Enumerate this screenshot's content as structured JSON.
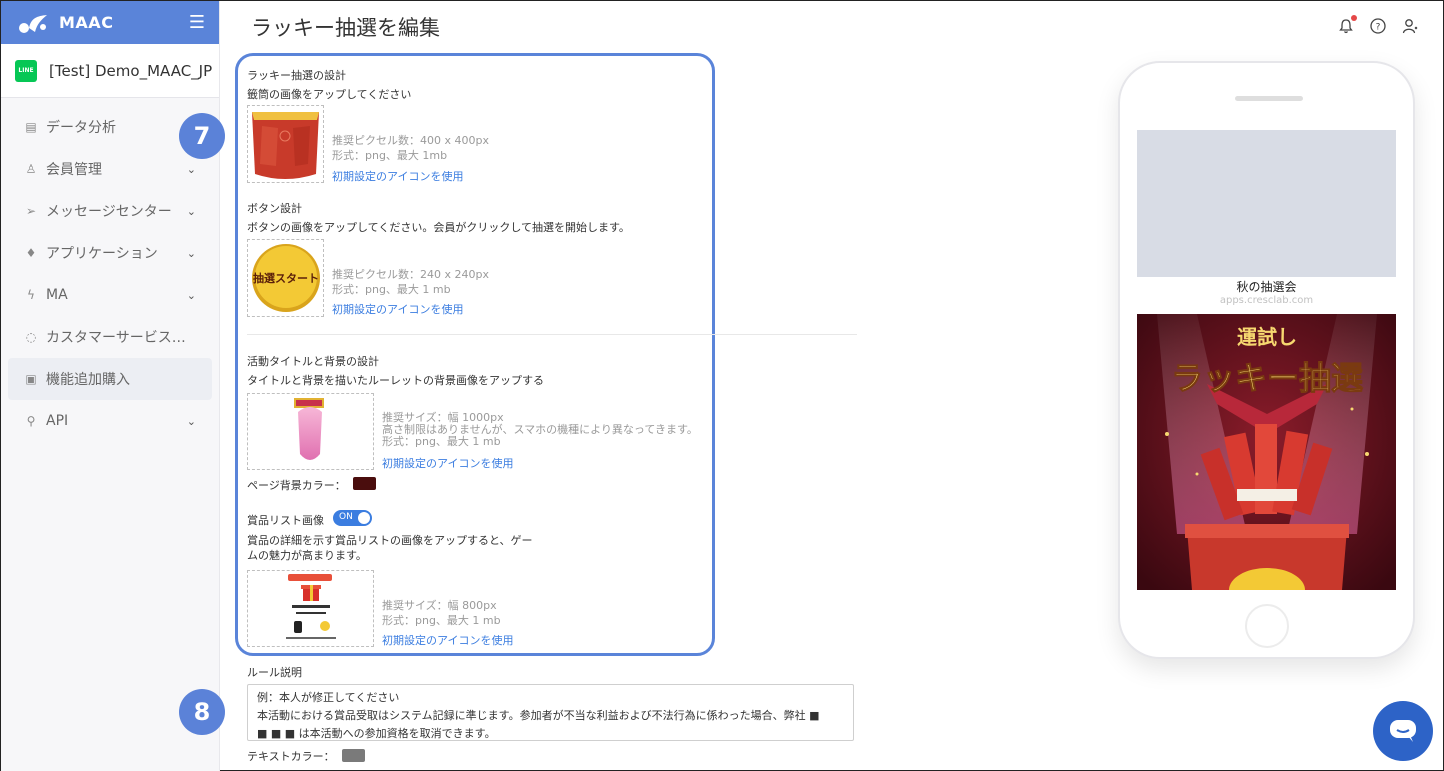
{
  "sidebar": {
    "brand": "MAAC",
    "account_name": "[Test] Demo_MAAC_JP",
    "line_badge": "LINE",
    "items": [
      {
        "label": "データ分析",
        "icon": "chart-icon",
        "chevron": false
      },
      {
        "label": "会員管理",
        "icon": "user-icon",
        "chevron": true
      },
      {
        "label": "メッセージセンター",
        "icon": "send-icon",
        "chevron": true
      },
      {
        "label": "アプリケーション",
        "icon": "rocket-icon",
        "chevron": true
      },
      {
        "label": "MA",
        "icon": "lightning-icon",
        "chevron": true
      },
      {
        "label": "カスタマーサービスチャット",
        "icon": "chat-icon",
        "chevron": false
      },
      {
        "label": "機能追加購入",
        "icon": "store-icon",
        "chevron": false,
        "active": true
      },
      {
        "label": "API",
        "icon": "api-icon",
        "chevron": true
      }
    ]
  },
  "header": {
    "title": "ラッキー抽選を編集"
  },
  "steps": {
    "step7": "7",
    "step8": "8"
  },
  "design": {
    "title": "ラッキー抽選の設計",
    "lottery_desc": "籤筒の画像をアップしてください",
    "lottery_hint1": "推奨ピクセル数：400 x 400px",
    "lottery_hint2": "形式：png、最大 1mb",
    "default_link": "初期設定のアイコンを使用",
    "button_title": "ボタン設計",
    "button_desc": "ボタンの画像をアップしてください。会員がクリックして抽選を開始します。",
    "button_img_text": "抽選スタート",
    "button_hint1": "推奨ピクセル数：240 x 240px",
    "button_hint2": "形式：png、最大 1 mb",
    "bg_title": "活動タイトルと背景の設計",
    "bg_desc": "タイトルと背景を描いたルーレットの背景画像をアップする",
    "bg_hint1": "推奨サイズ：幅 1000px",
    "bg_hint2": "高さ制限はありませんが、スマホの機種により異なってきます。",
    "bg_hint3": "形式：png、最大 1 mb",
    "bg_color_label": "ページ背景カラー：",
    "bg_color": "#4a0d0d",
    "prize_title": "賞品リスト画像",
    "prize_toggle": "ON",
    "prize_desc1": "賞品の詳細を示す賞品リストの画像をアップすると、ゲー",
    "prize_desc2": "ムの魅力が高まります。",
    "prize_hint1": "推奨サイズ：幅 800px",
    "prize_hint2": "形式：png、最大 1 mb"
  },
  "rules": {
    "title": "ルール説明",
    "line1": "例：本人が修正してください",
    "line2": "本活動における賞品受取はシステム記録に準じます。参加者が不当な利益および不法行為に係わった場合、弊社 ■",
    "line3": "■ ■ ■ は本活動への参加資格を取消できます。",
    "text_color_label": "テキストカラー：",
    "text_color": "#7a7a7a"
  },
  "preview": {
    "title": "秋の抽選会",
    "url": "apps.cresclab.com",
    "banner_top": "運試し",
    "banner_main": "ラッキー抽選"
  },
  "colors": {
    "accent": "#5a84d9",
    "link": "#3b7de0",
    "chat": "#2d63c7"
  }
}
